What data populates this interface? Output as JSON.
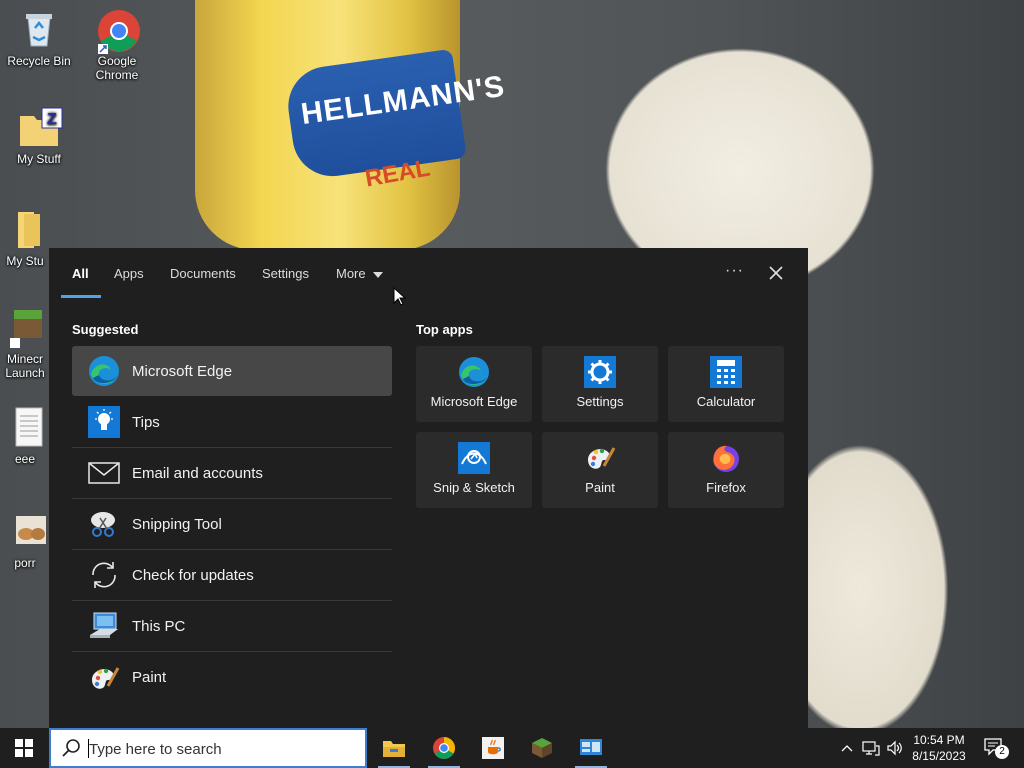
{
  "desktop": {
    "icons": [
      {
        "label": "Recycle Bin"
      },
      {
        "label": "Google Chrome"
      },
      {
        "label": "My Stuff"
      },
      {
        "label": "My Stu"
      },
      {
        "label": "Minecr Launch"
      },
      {
        "label": "eee"
      },
      {
        "label": "porr"
      }
    ],
    "wallpaper_text": {
      "brand": "HELLMANN'S",
      "sub": "REAL"
    }
  },
  "search_panel": {
    "tabs": [
      {
        "label": "All"
      },
      {
        "label": "Apps"
      },
      {
        "label": "Documents"
      },
      {
        "label": "Settings"
      },
      {
        "label": "More"
      }
    ],
    "more_options_label": "···",
    "suggested": {
      "title": "Suggested",
      "items": [
        {
          "label": "Microsoft Edge",
          "icon": "edge-icon"
        },
        {
          "label": "Tips",
          "icon": "lightbulb-icon"
        },
        {
          "label": "Email and accounts",
          "icon": "envelope-icon"
        },
        {
          "label": "Snipping Tool",
          "icon": "scissors-icon"
        },
        {
          "label": "Check for updates",
          "icon": "refresh-icon"
        },
        {
          "label": "This PC",
          "icon": "computer-icon"
        },
        {
          "label": "Paint",
          "icon": "palette-icon"
        }
      ]
    },
    "top_apps": {
      "title": "Top apps",
      "items": [
        {
          "label": "Microsoft Edge",
          "icon": "edge-icon"
        },
        {
          "label": "Settings",
          "icon": "gear-icon"
        },
        {
          "label": "Calculator",
          "icon": "calculator-icon"
        },
        {
          "label": "Snip & Sketch",
          "icon": "snip-sketch-icon"
        },
        {
          "label": "Paint",
          "icon": "palette-icon"
        },
        {
          "label": "Firefox",
          "icon": "firefox-icon"
        }
      ]
    }
  },
  "taskbar": {
    "search_placeholder": "Type here to search",
    "time": "10:54 PM",
    "date": "8/15/2023",
    "notification_count": "2"
  },
  "colors": {
    "panel_bg": "#1f1f1f",
    "accent": "#4fa3e8",
    "selected_bg": "#474747",
    "tile_bg": "#2b2b2b"
  }
}
